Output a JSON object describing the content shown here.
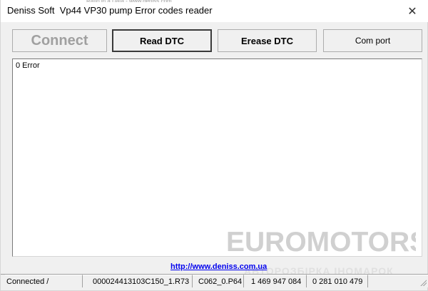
{
  "window": {
    "title": "Deniss Soft  Vp44 VP30 pump Error codes reader",
    "top_clip_text": "Ratio in a Data - www.deniss.com",
    "close_glyph": "✕"
  },
  "toolbar": {
    "connect_label": "Connect",
    "connect_enabled": false,
    "read_label": "Read DTC",
    "erease_label": "Erease DTC",
    "com_label": "Com port"
  },
  "output": {
    "text": "0 Error"
  },
  "link": {
    "text": "http://www.deniss.com.ua"
  },
  "statusbar": {
    "state": "Connected /",
    "fw_file": "000024413103C150_1.R73",
    "cal_file": "C062_0.P64",
    "pump_no": "1 469 947 084",
    "part_no": "0 281 010 479"
  },
  "watermark": {
    "brand": "EUROMOTORS",
    "tagline": "АВТОРОЗБІРКА ІНОМАРОК"
  },
  "colors": {
    "window_bg": "#f0f0f0",
    "disabled_text": "#a0a0a0",
    "link": "#0000ee",
    "watermark": "#d0d0d0"
  }
}
